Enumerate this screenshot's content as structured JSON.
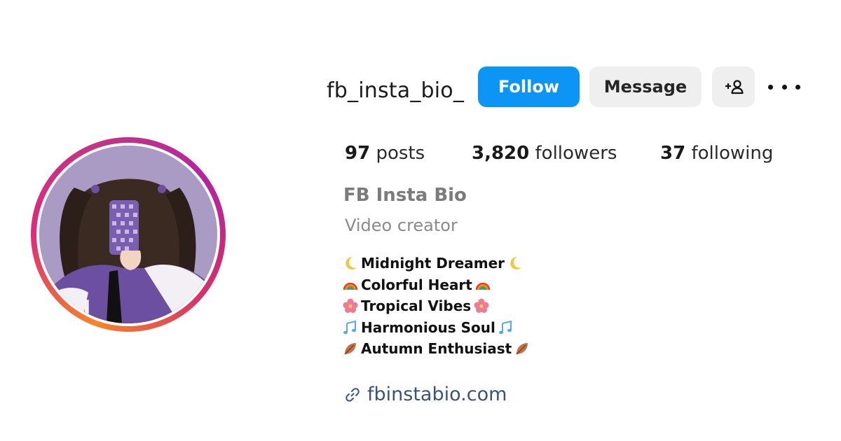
{
  "profile": {
    "username": "fb_insta_bio_",
    "display_name": "FB Insta Bio",
    "category": "Video creator",
    "website": "fbinstabio.com"
  },
  "actions": {
    "follow_label": "Follow",
    "message_label": "Message",
    "add_user_icon": "person-plus-icon",
    "more_icon": "more-options-icon"
  },
  "stats": {
    "posts_count": "97",
    "posts_label": "posts",
    "followers_count": "3,820",
    "followers_label": "followers",
    "following_count": "37",
    "following_label": "following"
  },
  "bio": [
    {
      "icon": "crescent-moon-icon",
      "text": "Midnight Dreamer"
    },
    {
      "icon": "rainbow-icon",
      "text": "Colorful Heart"
    },
    {
      "icon": "hibiscus-icon",
      "text": "Tropical Vibes"
    },
    {
      "icon": "musical-notes-icon",
      "text": "Harmonious Soul"
    },
    {
      "icon": "fallen-leaf-icon",
      "text": "Autumn Enthusiast"
    }
  ],
  "colors": {
    "follow_button": "#0d95f6",
    "secondary_button": "#efefef",
    "link": "#385478",
    "story_ring_start": "#f58529",
    "story_ring_end": "#b1269e"
  }
}
